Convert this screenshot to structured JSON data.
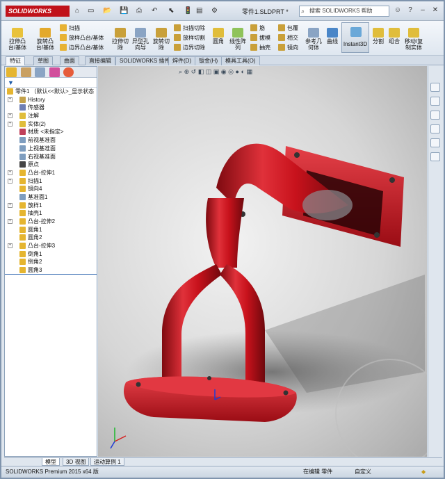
{
  "app": {
    "logo": "SOLIDWORKS",
    "doc_title": "零件1.SLDPRT *",
    "search_placeholder": "搜索 SOLIDWORKS 帮助"
  },
  "ribbon": {
    "large": [
      {
        "label": "拉伸凸\n台/基体"
      },
      {
        "label": "旋转凸\n台/基体"
      },
      {
        "label": "拉伸切\n除"
      },
      {
        "label": "异型孔\n向导"
      },
      {
        "label": "旋转切\n除"
      },
      {
        "label": "圆角"
      },
      {
        "label": "线性阵\n列"
      },
      {
        "label": "参考几\n何体"
      },
      {
        "label": "曲线"
      },
      {
        "label": "Instant3D"
      },
      {
        "label": "分割"
      },
      {
        "label": "组合"
      },
      {
        "label": "移动/复\n制实体"
      }
    ],
    "small": [
      {
        "label": "扫描"
      },
      {
        "label": "放样凸台/基体"
      },
      {
        "label": "边界凸台/基体"
      },
      {
        "label": "扫描切除"
      },
      {
        "label": "放样切割"
      },
      {
        "label": "边界切除"
      },
      {
        "label": "筋"
      },
      {
        "label": "拔模"
      },
      {
        "label": "抽壳"
      },
      {
        "label": "包覆"
      },
      {
        "label": "相交"
      },
      {
        "label": "镜向"
      }
    ]
  },
  "tabs": [
    "特征",
    "草图",
    "曲面",
    "直接编辑",
    "SOLIDWORKS 插件",
    "焊件(D)",
    "钣金(H)",
    "模具工具(O)"
  ],
  "tree": {
    "root": "零件1 （默认<<默认>_显示状态",
    "items": [
      {
        "label": "History",
        "exp": true
      },
      {
        "label": "传感器",
        "exp": false
      },
      {
        "label": "注解",
        "exp": true
      },
      {
        "label": "实体(2)",
        "exp": true
      },
      {
        "label": "材质 <未指定>",
        "exp": false
      },
      {
        "label": "前视基准面",
        "exp": false
      },
      {
        "label": "上视基准面",
        "exp": false
      },
      {
        "label": "右视基准面",
        "exp": false
      },
      {
        "label": "原点",
        "exp": false
      },
      {
        "label": "凸台-拉伸1",
        "exp": true
      },
      {
        "label": "扫描1",
        "exp": true
      },
      {
        "label": "镜向4",
        "exp": false
      },
      {
        "label": "基准面1",
        "exp": false
      },
      {
        "label": "放样1",
        "exp": true
      },
      {
        "label": "抽壳1",
        "exp": false
      },
      {
        "label": "凸台-拉伸2",
        "exp": true
      },
      {
        "label": "圆角1",
        "exp": false
      },
      {
        "label": "圆角2",
        "exp": false
      },
      {
        "label": "凸台-拉伸3",
        "exp": true
      },
      {
        "label": "倒角1",
        "exp": false
      },
      {
        "label": "倒角2",
        "exp": false
      },
      {
        "label": "圆角3",
        "exp": false
      }
    ]
  },
  "bottom_tabs": [
    "模型",
    "3D 视图",
    "运动算例 1"
  ],
  "status": {
    "left": "SOLIDWORKS Premium 2015 x64 版",
    "mid": "在编辑 零件",
    "right": "自定义"
  },
  "colors": {
    "part_red": "#d7141e",
    "accent": "#c0121a"
  }
}
